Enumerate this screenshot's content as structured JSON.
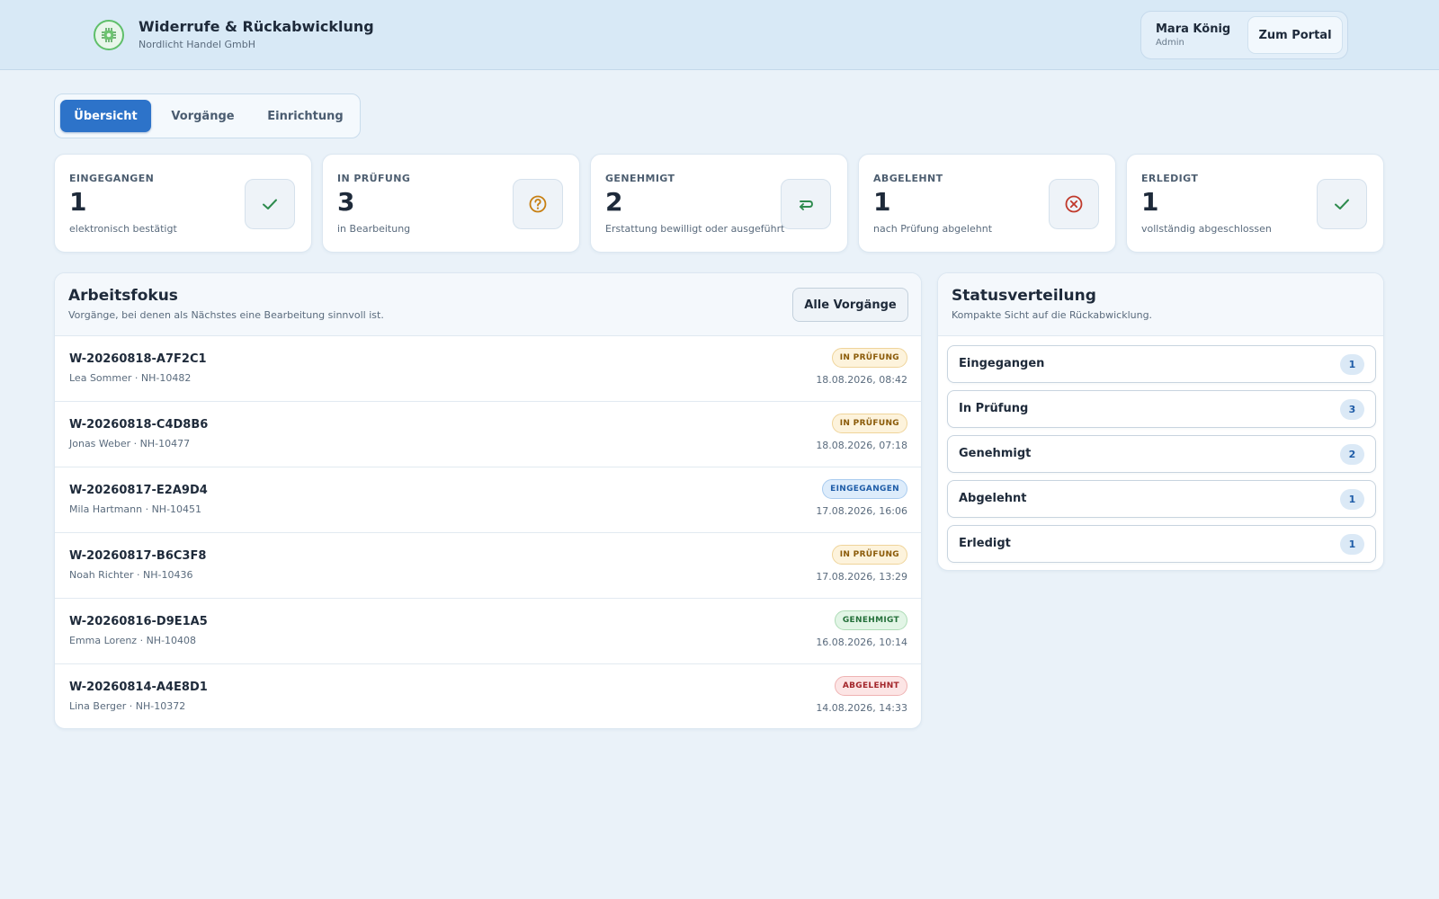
{
  "header": {
    "title": "Widerrufe & Rückabwicklung",
    "company": "Nordlicht Handel GmbH",
    "logo_icon": "chip-gear-icon",
    "user": {
      "name": "Mara König",
      "role": "Admin"
    },
    "portal_button": "Zum Portal"
  },
  "tabs": [
    {
      "label": "Übersicht",
      "active": true
    },
    {
      "label": "Vorgänge",
      "active": false
    },
    {
      "label": "Einrichtung",
      "active": false
    }
  ],
  "kpis": [
    {
      "label": "EINGEGANGEN",
      "value": "1",
      "description": "elektronisch bestätigt",
      "icon": "check-icon",
      "icon_color": "#2e8b4e"
    },
    {
      "label": "IN PRÜFUNG",
      "value": "3",
      "description": "in Bearbeitung",
      "icon": "question-circle-icon",
      "icon_color": "#c77f12"
    },
    {
      "label": "GENEHMIGT",
      "value": "2",
      "description": "Erstattung bewilligt oder ausgeführt",
      "icon": "return-arrow-icon",
      "icon_color": "#2e8b4e"
    },
    {
      "label": "ABGELEHNT",
      "value": "1",
      "description": "nach Prüfung abgelehnt",
      "icon": "x-circle-icon",
      "icon_color": "#c0392b"
    },
    {
      "label": "ERLEDIGT",
      "value": "1",
      "description": "vollständig abgeschlossen",
      "icon": "check-icon",
      "icon_color": "#2e8b4e"
    }
  ],
  "focus": {
    "title": "Arbeitsfokus",
    "subtitle": "Vorgänge, bei denen als Nächstes eine Bearbeitung sinnvoll ist.",
    "button": "Alle Vorgänge",
    "cases": [
      {
        "id": "W-20260818-A7F2C1",
        "meta": "Lea Sommer · NH-10482",
        "status": "IN PRÜFUNG",
        "status_kind": "review",
        "date": "18.08.2026, 08:42"
      },
      {
        "id": "W-20260818-C4D8B6",
        "meta": "Jonas Weber · NH-10477",
        "status": "IN PRÜFUNG",
        "status_kind": "review",
        "date": "18.08.2026, 07:18"
      },
      {
        "id": "W-20260817-E2A9D4",
        "meta": "Mila Hartmann · NH-10451",
        "status": "EINGEGANGEN",
        "status_kind": "new",
        "date": "17.08.2026, 16:06"
      },
      {
        "id": "W-20260817-B6C3F8",
        "meta": "Noah Richter · NH-10436",
        "status": "IN PRÜFUNG",
        "status_kind": "review",
        "date": "17.08.2026, 13:29"
      },
      {
        "id": "W-20260816-D9E1A5",
        "meta": "Emma Lorenz · NH-10408",
        "status": "GENEHMIGT",
        "status_kind": "approved",
        "date": "16.08.2026, 10:14"
      },
      {
        "id": "W-20260814-A4E8D1",
        "meta": "Lina Berger · NH-10372",
        "status": "ABGELEHNT",
        "status_kind": "rejected",
        "date": "14.08.2026, 14:33"
      }
    ]
  },
  "distribution": {
    "title": "Statusverteilung",
    "subtitle": "Kompakte Sicht auf die Rückabwicklung.",
    "items": [
      {
        "label": "Eingegangen",
        "count": "1"
      },
      {
        "label": "In Prüfung",
        "count": "3"
      },
      {
        "label": "Genehmigt",
        "count": "2"
      },
      {
        "label": "Abgelehnt",
        "count": "1"
      },
      {
        "label": "Erledigt",
        "count": "1"
      }
    ]
  }
}
